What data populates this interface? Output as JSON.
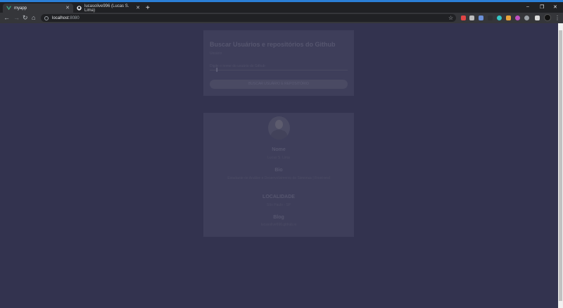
{
  "browser": {
    "tabs": [
      {
        "title": "myapp",
        "active": true
      },
      {
        "title": "lucasolive996 (Lucas S. Lima)",
        "active": false
      }
    ],
    "url_host": "localhost",
    "url_port": ":8080",
    "new_tab_label": "+",
    "tab_close": "✕",
    "window_controls": {
      "minimize": "–",
      "maximize": "❐",
      "close": "✕"
    },
    "nav": {
      "back": "←",
      "forward": "→",
      "reload": "↻",
      "home": "⌂"
    },
    "star": "☆",
    "kebab": "⋮",
    "accent": "#2b7fd6"
  },
  "search_card": {
    "title": "Buscar Usuários e repositórios do Github",
    "subtitle": "Usuário",
    "input_placeholder": "Digite o nome do usuário do Github",
    "button_label": "BUSCAR USUÁRIO E REPOSITÓRIO",
    "cursor": "I"
  },
  "profile_card": {
    "sections": [
      {
        "title": "Nome",
        "text": "Lucas S. Lima"
      },
      {
        "title": "Bio",
        "text": "Estudante de Análise e Desenvolvimento de Sistemas | Front-end"
      },
      {
        "title": "LOCALIDADE",
        "text": "São Paulo - SP"
      },
      {
        "title": "Blog",
        "text": "lucasolive996.github.io"
      }
    ]
  },
  "colors": {
    "page_background": "#33334f",
    "card_background": "#3e3e5a"
  }
}
